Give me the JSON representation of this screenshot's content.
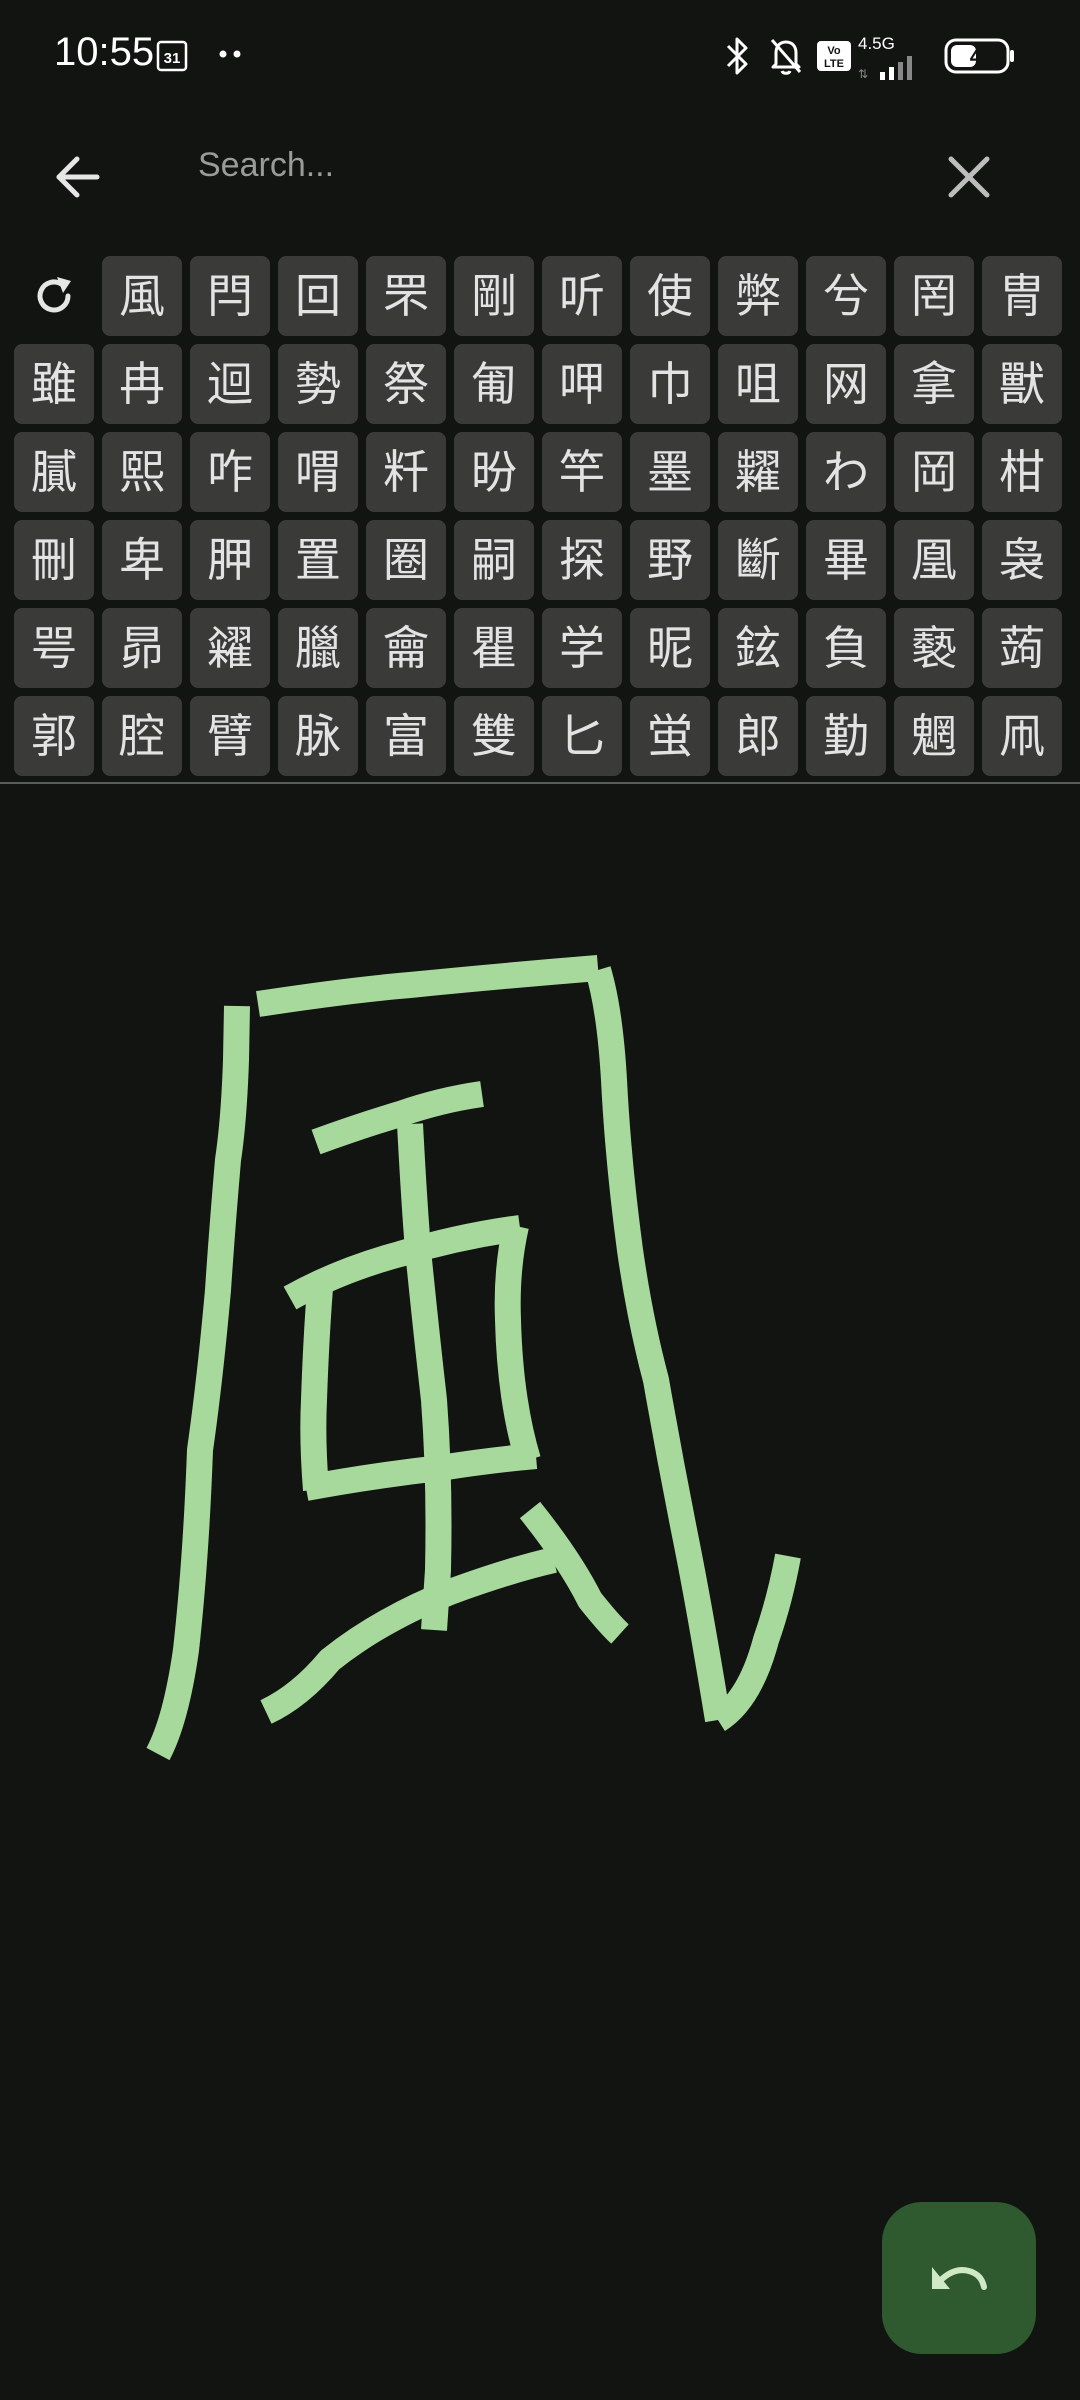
{
  "status_bar": {
    "time": "10:55",
    "calendar_day": "31",
    "network_label": "4.5G",
    "volte_label": "Vo LTE",
    "battery_level": "43"
  },
  "search": {
    "placeholder": "Search..."
  },
  "candidates": [
    "風",
    "閂",
    "回",
    "罘",
    "剛",
    "听",
    "使",
    "弊",
    "兮",
    "罔",
    "冑",
    "雖",
    "冉",
    "迴",
    "勢",
    "祭",
    "匍",
    "呷",
    "巾",
    "咀",
    "网",
    "拿",
    "獸",
    "膩",
    "熙",
    "咋",
    "喟",
    "粁",
    "昐",
    "竿",
    "墨",
    "糶",
    "わ",
    "岡",
    "柑",
    "刪",
    "卑",
    "胛",
    "置",
    "圈",
    "嗣",
    "探",
    "野",
    "斷",
    "畢",
    "凰",
    "袅",
    "咢",
    "昴",
    "糴",
    "臘",
    "龠",
    "瞿",
    "学",
    "昵",
    "鉉",
    "負",
    "褻",
    "蒟",
    "郭",
    "腔",
    "臂",
    "脉",
    "富",
    "雙",
    "匕",
    "蛍",
    "郎",
    "勤",
    "魍",
    "凧"
  ],
  "icons": {
    "refresh": "refresh-icon",
    "back": "arrow-left-icon",
    "clear": "close-icon",
    "undo": "undo-icon"
  },
  "colors": {
    "background": "#121412",
    "candidate_bg": "#3a3b39",
    "stroke": "#a8d99c",
    "fab": "#2f5a2f"
  }
}
